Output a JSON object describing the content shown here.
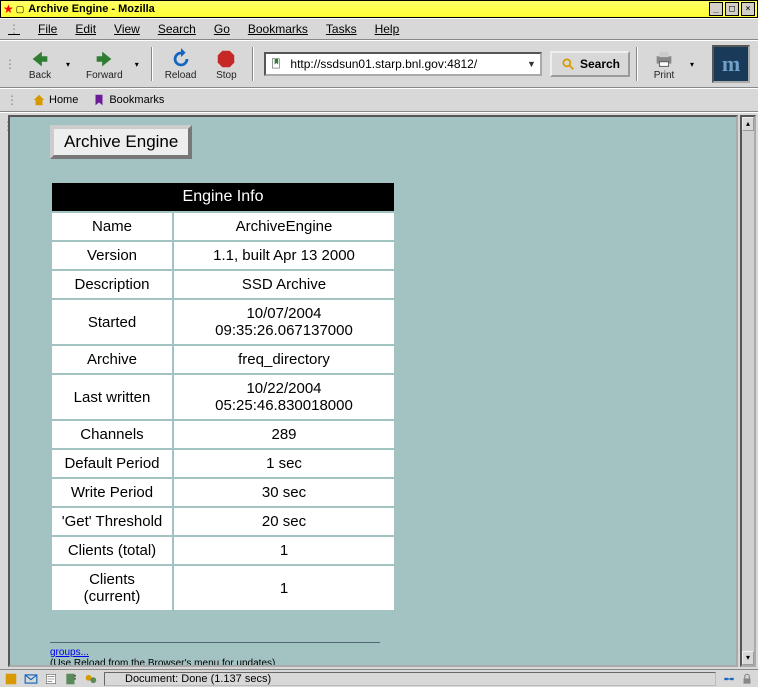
{
  "window": {
    "title": "Archive Engine - Mozilla"
  },
  "menu": {
    "file": "File",
    "edit": "Edit",
    "view": "View",
    "search": "Search",
    "go": "Go",
    "bookmarks": "Bookmarks",
    "tasks": "Tasks",
    "help": "Help"
  },
  "toolbar": {
    "back": "Back",
    "forward": "Forward",
    "reload": "Reload",
    "stop": "Stop",
    "url": "http://ssdsun01.starp.bnl.gov:4812/",
    "search": "Search",
    "print": "Print"
  },
  "personal": {
    "home": "Home",
    "bookmarks": "Bookmarks"
  },
  "page": {
    "title": "Archive Engine",
    "table_header": "Engine Info",
    "rows": [
      {
        "label": "Name",
        "value": "ArchiveEngine"
      },
      {
        "label": "Version",
        "value": "1.1, built Apr 13 2000"
      },
      {
        "label": "Description",
        "value": "SSD Archive"
      },
      {
        "label": "Started",
        "value": "10/07/2004 09:35:26.067137000"
      },
      {
        "label": "Archive",
        "value": "freq_directory"
      },
      {
        "label": "Last written",
        "value": "10/22/2004 05:25:46.830018000"
      },
      {
        "label": "Channels",
        "value": "289"
      },
      {
        "label": "Default Period",
        "value": "1 sec"
      },
      {
        "label": "Write Period",
        "value": "30 sec"
      },
      {
        "label": "'Get' Threshold",
        "value": "20 sec"
      },
      {
        "label": "Clients (total)",
        "value": "1"
      },
      {
        "label": "Clients (current)",
        "value": "1"
      }
    ],
    "link": "groups...",
    "note": "(Use Reload from the Browser's menu for updates)"
  },
  "status": {
    "message": "Document: Done (1.137 secs)"
  }
}
